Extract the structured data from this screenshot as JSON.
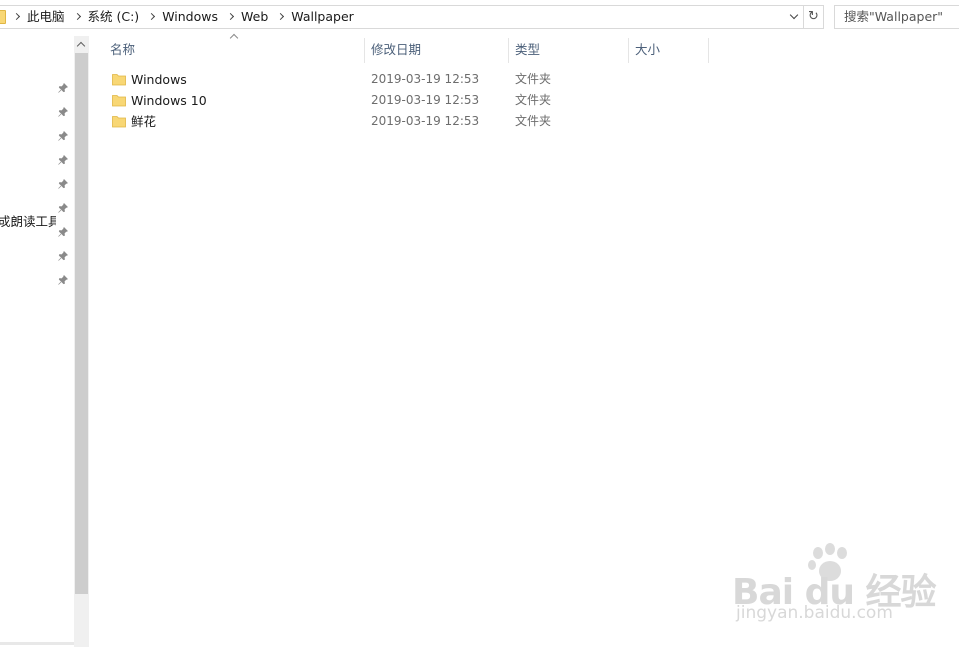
{
  "address_bar": {
    "breadcrumbs": [
      "此电脑",
      "系统 (C:)",
      "Windows",
      "Web",
      "Wallpaper"
    ]
  },
  "search": {
    "placeholder": "搜索\"Wallpaper\""
  },
  "nav_pane": {
    "visible_text": "戓朗读工具\\",
    "pin_count": 9
  },
  "columns": {
    "name": "名称",
    "date_modified": "修改日期",
    "type": "类型",
    "size": "大小"
  },
  "files": [
    {
      "name": "Windows",
      "date": "2019-03-19 12:53",
      "type": "文件夹"
    },
    {
      "name": "Windows 10",
      "date": "2019-03-19 12:53",
      "type": "文件夹"
    },
    {
      "name": "鲜花",
      "date": "2019-03-19 12:53",
      "type": "文件夹"
    }
  ],
  "watermark": {
    "logo_text": "Bai du 经验",
    "site": "jingyan.baidu.com"
  },
  "colors": {
    "folder_yellow": "#f8d775",
    "header_text": "#4c607a",
    "secondary_text": "#6d6d6d",
    "watermark": "#d8d8d8"
  }
}
